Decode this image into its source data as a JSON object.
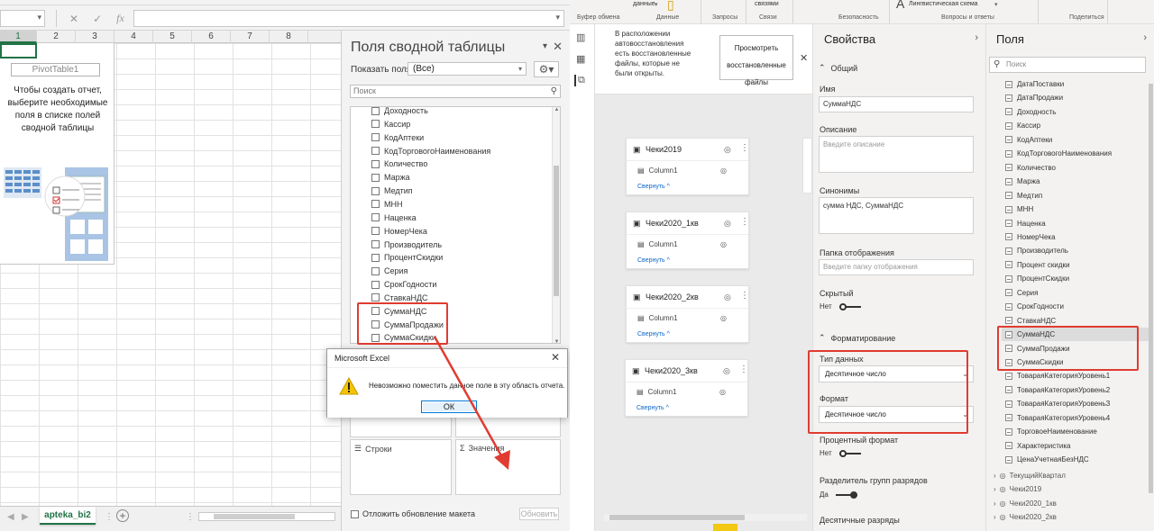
{
  "excel": {
    "formula_bar": {
      "namebox_value": "",
      "fx_symbol": "fx",
      "cancel_symbol": "✕",
      "enter_symbol": "✓",
      "formula_value": ""
    },
    "columns": [
      "1",
      "2",
      "3",
      "4",
      "5",
      "6",
      "7",
      "8"
    ],
    "pivot_placeholder": {
      "name": "PivotTable1",
      "instructions": "Чтобы создать отчет, выберите необходимые поля в списке полей сводной таблицы"
    },
    "sheet_tab": "apteka_bi2"
  },
  "pivot_pane": {
    "title": "Поля сводной таблицы",
    "show_fields_label": "Показать поля:",
    "show_fields_value": "(Все)",
    "search_placeholder": "Поиск",
    "fields": [
      "Доходность",
      "Кассир",
      "КодАптеки",
      "КодТорговогоНаименования",
      "Количество",
      "Маржа",
      "Медтип",
      "МНН",
      "Наценка",
      "НомерЧека",
      "Производитель",
      "ПроцентСкидки",
      "Серия",
      "СрокГодности",
      "СтавкаНДС",
      "СуммаНДС",
      "СуммаПродажи",
      "СуммаСкидки"
    ],
    "areas": {
      "rows": "Строки",
      "values": "Значения"
    },
    "defer_label": "Отложить обновление макета",
    "update_button": "Обновить"
  },
  "dialog": {
    "title": "Microsoft Excel",
    "message": "Невозможно поместить данное поле в эту область отчета.",
    "ok": "ОК"
  },
  "pbi": {
    "ribbon": {
      "groups": [
        "Буфер обмена",
        "Данные",
        "Запросы",
        "Связи",
        "Безопасность",
        "Вопросы и ответы",
        "Поделиться"
      ],
      "items": [
        "данные",
        "связями",
        "Лингвистическая схема"
      ]
    },
    "recovery": {
      "message": "В расположении автовосстановления есть восстановленные файлы, которые не были открыты.",
      "button": "Просмотреть восстановленные файлы"
    },
    "tables": [
      {
        "name": "Чеки2019",
        "column": "Column1",
        "collapse": "Свернуть"
      },
      {
        "name": "Чеки2020_1кв",
        "column": "Column1",
        "collapse": "Свернуть"
      },
      {
        "name": "Чеки2020_2кв",
        "column": "Column1",
        "collapse": "Свернуть"
      },
      {
        "name": "Чеки2020_3кв",
        "column": "Column1",
        "collapse": "Свернуть"
      }
    ],
    "properties": {
      "title": "Свойства",
      "general": "Общий",
      "name_label": "Имя",
      "name_value": "СуммаНДС",
      "description_label": "Описание",
      "description_placeholder": "Введите описание",
      "synonyms_label": "Синонимы",
      "synonyms_value": "сумма НДС, СуммаНДС",
      "folder_label": "Папка отображения",
      "folder_placeholder": "Введите папку отображения",
      "hidden_label": "Скрытый",
      "hidden_value": "Нет",
      "formatting": "Форматирование",
      "datatype_label": "Тип данных",
      "datatype_value": "Десятичное число",
      "format_label": "Формат",
      "format_value": "Десятичное число",
      "percent_label": "Процентный формат",
      "percent_value": "Нет",
      "thousands_label": "Разделитель групп разрядов",
      "thousands_value": "Да",
      "decimals_label": "Десятичные разряды"
    },
    "fields_pane": {
      "title": "Поля",
      "search_placeholder": "Поиск",
      "fields": [
        "ДатаПоставки",
        "ДатаПродажи",
        "Доходность",
        "Кассир",
        "КодАптеки",
        "КодТорговогоНаименования",
        "Количество",
        "Маржа",
        "Медтип",
        "МНН",
        "Наценка",
        "НомерЧека",
        "Производитель",
        "Процент скидки",
        "ПроцентСкидки",
        "Серия",
        "СрокГодности",
        "СтавкаНДС",
        "СуммаНДС",
        "СуммаПродажи",
        "СуммаСкидки",
        "ТовараяКатегорияУровень1",
        "ТовараяКатегорияУровень2",
        "ТовараяКатегорияУровень3",
        "ТовараяКатегорияУровень4",
        "ТорговоеНаименование",
        "Характеристика",
        "ЦенаУчетнаяБезНДС"
      ],
      "tables": [
        "ТекущийКвартал",
        "Чеки2019",
        "Чеки2020_1кв",
        "Чеки2020_2кв"
      ]
    },
    "highlight_color": "#e03c31"
  }
}
